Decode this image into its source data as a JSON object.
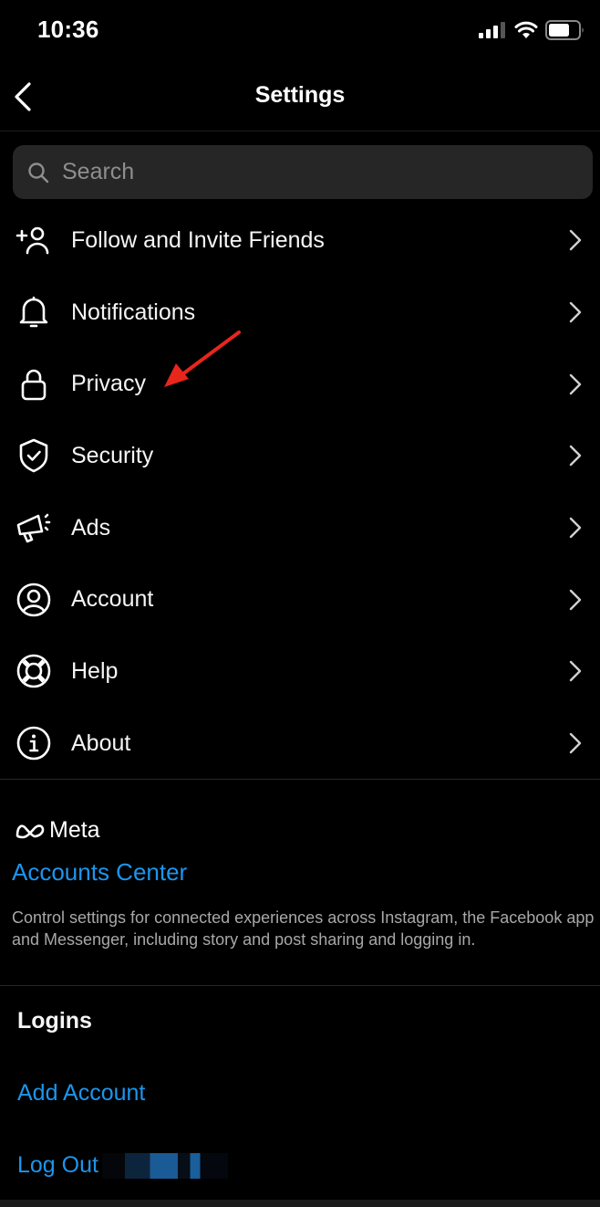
{
  "status_bar": {
    "time": "10:36",
    "icons": [
      "cellular-signal-icon",
      "wifi-icon",
      "battery-icon"
    ]
  },
  "nav": {
    "title": "Settings",
    "back_icon": "chevron-left-icon"
  },
  "search": {
    "placeholder": "Search",
    "value": "",
    "icon": "search-icon"
  },
  "menu": {
    "items": [
      {
        "label": "Follow and Invite Friends",
        "icon": "add-person-icon"
      },
      {
        "label": "Notifications",
        "icon": "bell-icon"
      },
      {
        "label": "Privacy",
        "icon": "lock-icon"
      },
      {
        "label": "Security",
        "icon": "shield-check-icon"
      },
      {
        "label": "Ads",
        "icon": "megaphone-icon"
      },
      {
        "label": "Account",
        "icon": "user-circle-icon"
      },
      {
        "label": "Help",
        "icon": "lifebuoy-icon"
      },
      {
        "label": "About",
        "icon": "info-icon"
      }
    ]
  },
  "meta_section": {
    "brand": "Meta",
    "link": "Accounts Center",
    "description": "Control settings for connected experiences across Instagram, the Facebook app and Messenger, including story and post sharing and logging in."
  },
  "logins": {
    "title": "Logins",
    "add_account": "Add Account",
    "log_out": "Log Out"
  },
  "annotation": {
    "arrow_color": "#e8261c",
    "points_to": "Privacy"
  },
  "colors": {
    "background": "#000000",
    "link_blue": "#1d95ec",
    "search_bg": "#262626"
  }
}
